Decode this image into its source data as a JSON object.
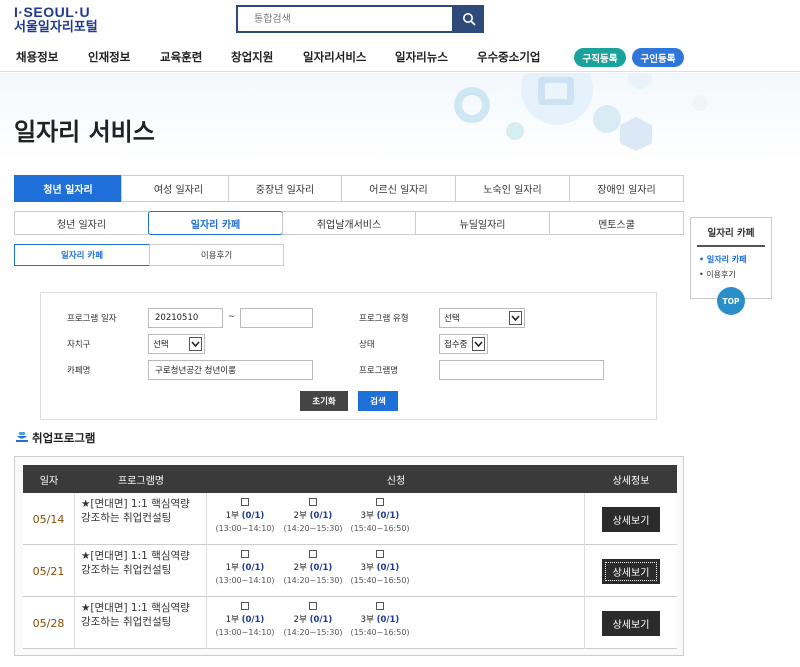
{
  "header": {
    "logo_top": "I·SEOUL·U",
    "logo_bottom": "서울일자리포털",
    "search_placeholder": "통합검색"
  },
  "gnb": {
    "items": [
      "채용정보",
      "인재정보",
      "교육훈련",
      "창업지원",
      "일자리서비스",
      "일자리뉴스",
      "우수중소기업"
    ],
    "btn_job_seeker": "구직등록",
    "btn_job_offer": "구인등록",
    "job_seeker_color": "#1aa39a",
    "job_offer_color": "#2f76db"
  },
  "page_title": "일자리 서비스",
  "tabs_level1": [
    "청년 일자리",
    "여성 일자리",
    "중장년 일자리",
    "어르신 일자리",
    "노숙인 일자리",
    "장애인 일자리"
  ],
  "tabs_level2": [
    "청년 일자리",
    "일자리 카페",
    "취업날개서비스",
    "뉴딜일자리",
    "멘토스쿨"
  ],
  "tabs_level3": [
    "일자리 카페",
    "이용후기"
  ],
  "side": {
    "title": "일자리 카페",
    "items": [
      "일자리 카페",
      "이용후기"
    ],
    "top": "TOP"
  },
  "form": {
    "program_date_label": "프로그램 일자",
    "date_from": "20210510",
    "date_sep": "~",
    "date_to": "",
    "program_type_label": "프로그램 유형",
    "program_type_value": "선택",
    "district_label": "자치구",
    "district_value": "선택",
    "status_label": "상태",
    "status_value": "접수중",
    "cafe_label": "카페명",
    "cafe_value": "구로청년공간 청년이룸",
    "program_name_label": "프로그램명",
    "program_name_value": "",
    "reset": "초기화",
    "search": "검색"
  },
  "section_title": "취업프로그램",
  "table": {
    "headers": [
      "일자",
      "프로그램명",
      "신청",
      "상세정보"
    ],
    "rows": [
      {
        "date": "05/14",
        "name": "★[면대면] 1:1 핵심역량 강조하는 취업컨설팅",
        "slots": [
          {
            "label": "1부",
            "count": "(0/1)",
            "time": "(13:00~14:10)"
          },
          {
            "label": "2부",
            "count": "(0/1)",
            "time": "(14:20~15:30)"
          },
          {
            "label": "3부",
            "count": "(0/1)",
            "time": "(15:40~16:50)"
          }
        ],
        "detail": "상세보기"
      },
      {
        "date": "05/21",
        "name": "★[면대면] 1:1 핵심역량 강조하는 취업컨설팅",
        "slots": [
          {
            "label": "1부",
            "count": "(0/1)",
            "time": "(13:00~14:10)"
          },
          {
            "label": "2부",
            "count": "(0/1)",
            "time": "(14:20~15:30)"
          },
          {
            "label": "3부",
            "count": "(0/1)",
            "time": "(15:40~16:50)"
          }
        ],
        "detail": "상세보기"
      },
      {
        "date": "05/28",
        "name": "★[면대면] 1:1 핵심역량 강조하는 취업컨설팅",
        "slots": [
          {
            "label": "1부",
            "count": "(0/1)",
            "time": "(13:00~14:10)"
          },
          {
            "label": "2부",
            "count": "(0/1)",
            "time": "(14:20~15:30)"
          },
          {
            "label": "3부",
            "count": "(0/1)",
            "time": "(15:40~16:50)"
          }
        ],
        "detail": "상세보기"
      }
    ]
  },
  "colors": {
    "primary_blue": "#1e6fd8",
    "navy": "#1f3a93",
    "header_dark": "#3a3a3a"
  }
}
